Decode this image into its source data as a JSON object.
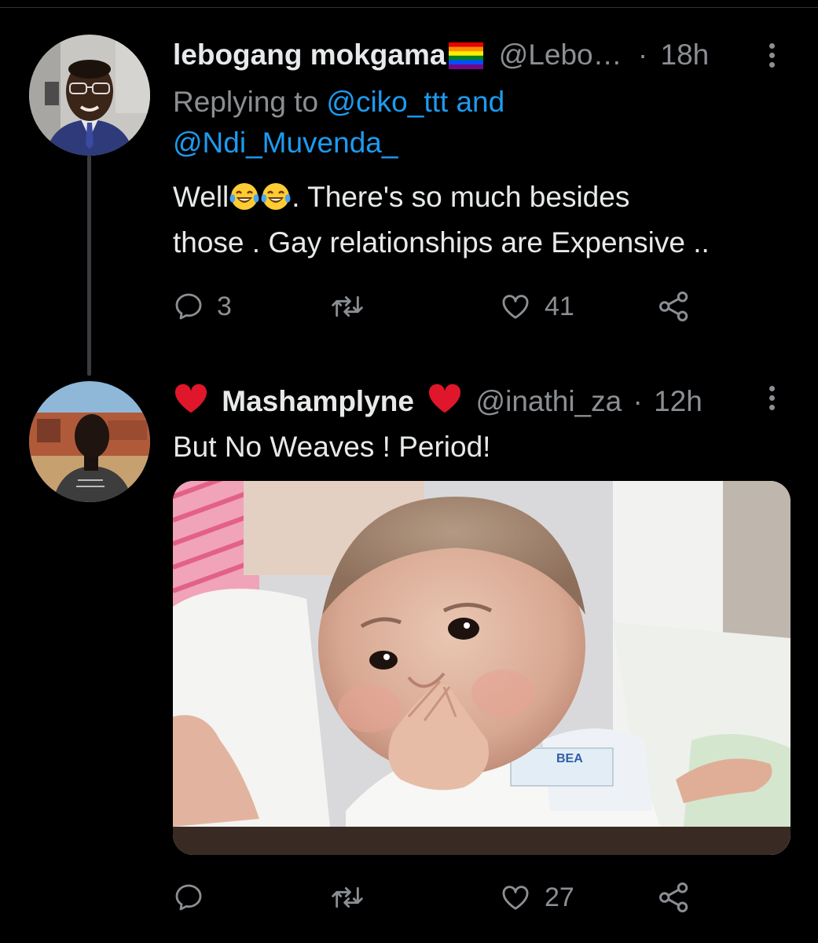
{
  "tweets": [
    {
      "display_name": "lebogang mokgama",
      "handle": "@Lebo…",
      "separator": "·",
      "time": "18h",
      "reply_prefix": "Replying to",
      "reply_to_1": "@ciko_ttt",
      "reply_and": "and",
      "reply_to_2": "@Ndi_Muvenda_",
      "text_line1_start": "Well",
      "text_line1_end": ". There's so much besides",
      "text_line2": "those . Gay relationships are Expensive ..",
      "reply_count": "3",
      "retweet_count": "",
      "like_count": "41"
    },
    {
      "display_name": "Mashamplyne",
      "handle": "@inathi_za",
      "separator": "·",
      "time": "12h",
      "text": "But No Weaves ! Period!",
      "media_label": "BEA",
      "reply_count": "",
      "retweet_count": "",
      "like_count": "27"
    }
  ],
  "colors": {
    "background": "#000000",
    "text": "#e7e9ea",
    "muted": "#8b8f93",
    "link": "#1d9bf0",
    "heart": "#e0162b"
  },
  "icons": [
    "reply-icon",
    "retweet-icon",
    "like-icon",
    "share-icon",
    "more-icon",
    "rainbow-flag-icon",
    "laughing-crying-emoji",
    "red-heart-emoji"
  ]
}
